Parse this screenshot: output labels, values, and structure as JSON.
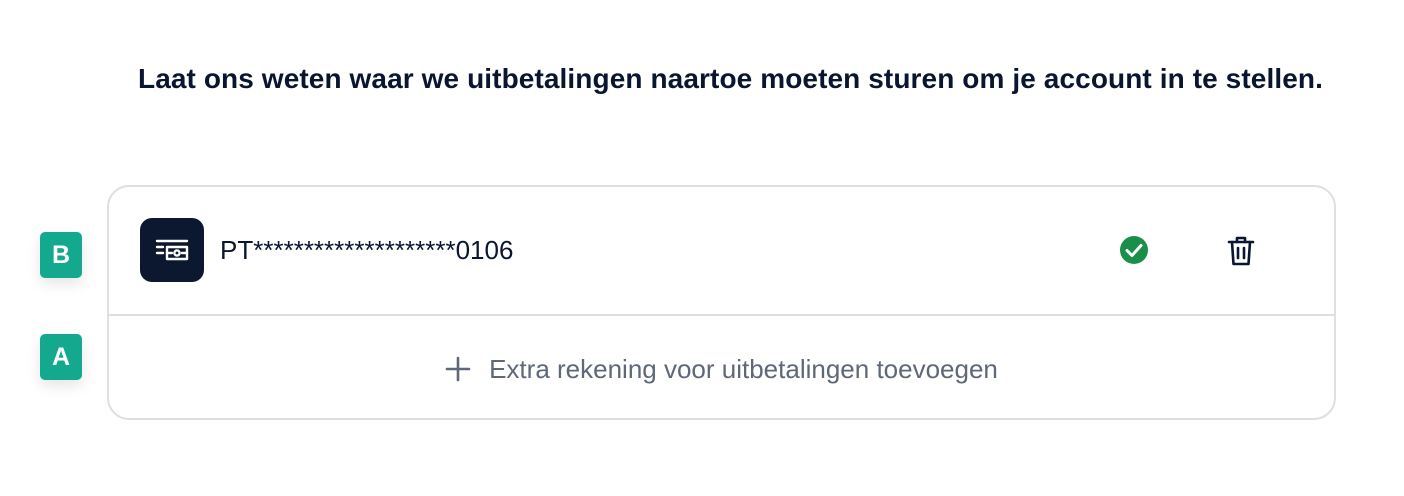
{
  "heading": "Laat ons weten waar we uitbetalingen naartoe moeten sturen om je account in te stellen.",
  "account": {
    "icon": "bank-card-icon",
    "iban": "PT********************0106",
    "status_icon": "verified-check-icon",
    "delete_icon": "trash-icon"
  },
  "add_account": {
    "icon": "plus-icon",
    "label": "Extra rekening voor uitbetalingen toevoegen"
  },
  "markers": {
    "b": "B",
    "a": "A"
  },
  "colors": {
    "heading": "#0a1530",
    "icon_bg": "#0c1730",
    "check": "#1a8f4a",
    "muted": "#5e6878",
    "border": "#dcdfe3",
    "marker": "#14a88f"
  }
}
